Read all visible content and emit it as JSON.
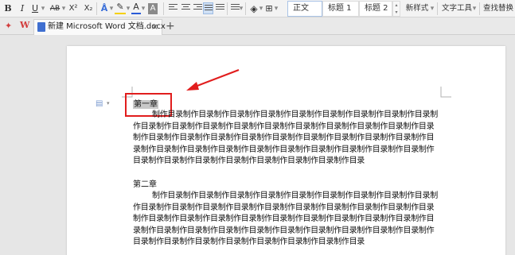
{
  "toolbar": {
    "bold": "B",
    "italic": "I",
    "underline": "U",
    "strike": "AB",
    "superscript": "X²",
    "subscript": "X₂",
    "font_color": "A",
    "char_shading": "A",
    "style_normal": "正文",
    "style_h1": "标题 1",
    "style_h2": "标题 2",
    "new_style": "新样式",
    "text_tools": "文字工具",
    "find_replace": "查找替换"
  },
  "tabs": {
    "doc_title": "新建 Microsoft Word 文档.docx",
    "close": "×",
    "add": "+"
  },
  "document": {
    "chapter1_title": "第一章",
    "chapter1_body": "制作目录制作目录制作目录制作目录制作目录制作目录制作目录制作目录制作目录制作目录制作目录制作目录制作目录制作目录制作目录制作目录制作目录制作目录制作目录制作目录制作目录制作目录制作目录制作目录制作目录制作目录制作目录制作目录制作目录制作目录制作目录制作目录制作目录制作目录制作目录制作目录制作目录制作目录制作目录制作目录制作目录制作目录制作目录制作目录制作目录制作目录",
    "chapter2_title": "第二章",
    "chapter2_body": "制作目录制作目录制作目录制作目录制作目录制作目录制作目录制作目录制作目录制作目录制作目录制作目录制作目录制作目录制作目录制作目录制作目录制作目录制作目录制作目录制作目录制作目录制作目录制作目录制作目录制作目录制作目录制作目录制作目录制作目录制作目录制作目录制作目录制作目录制作目录制作目录制作目录制作目录制作目录制作目录制作目录制作目录制作目录制作目录制作目录制作目录"
  },
  "colors": {
    "annotation_red": "#e11d1d",
    "font_color_underline": "#2a5bd7",
    "highlight_underline": "#f5d000"
  }
}
